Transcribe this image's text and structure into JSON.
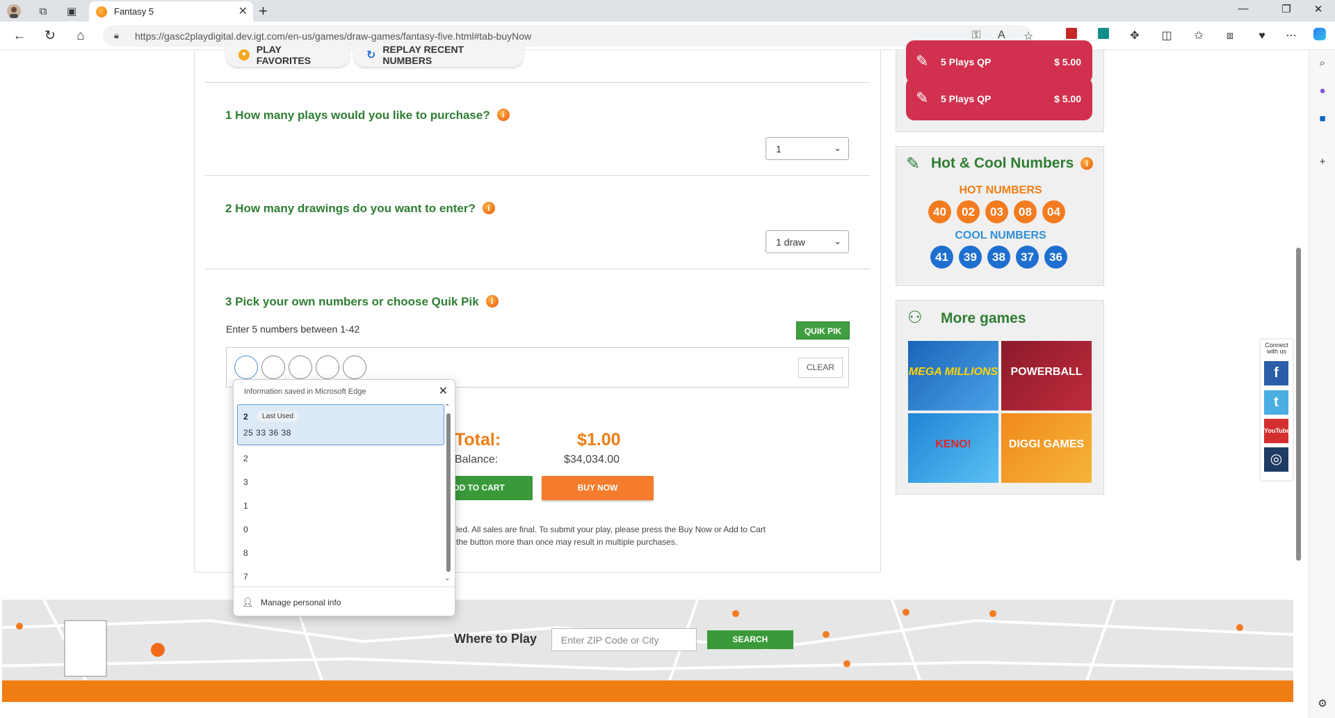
{
  "browser": {
    "tab_title": "Fantasy 5",
    "tab_close": "✕",
    "new_tab": "+",
    "url": "https://gasc2playdigital.dev.igt.com/en-us/games/draw-games/fantasy-five.html#tab-buyNow"
  },
  "favorites_buttons": {
    "play_favorites": "PLAY FAVORITES",
    "replay_recent": "REPLAY RECENT NUMBERS"
  },
  "questions": {
    "q1": "1 How many plays would you like to purchase?",
    "q1_value": "1",
    "q2": "2 How many drawings do you want to enter?",
    "q2_value": "1 draw",
    "q3": "3 Pick your own numbers or choose Quik Pik",
    "q3_hint": "Enter 5 numbers between 1-42",
    "quik_pik": "QUIK PIK",
    "clear": "CLEAR"
  },
  "summary": {
    "total_label": "Total:",
    "total_value": "$1.00",
    "balance_label": "Balance:",
    "balance_value": "$34,034.00",
    "add_to_cart": "DD TO CART",
    "buy_now": "BUY NOW",
    "disclaimer_1": "led. All sales are final. To submit your play, please press the Buy Now or Add to Cart",
    "disclaimer_2": "the button more than once may result in multiple purchases."
  },
  "quick_plays": [
    {
      "label": "5 Plays QP",
      "price": "$ 5.00"
    },
    {
      "label": "5 Plays QP",
      "price": "$ 5.00"
    }
  ],
  "hot_cool": {
    "title": "Hot & Cool Numbers",
    "hot_label": "HOT NUMBERS",
    "hot": [
      "40",
      "02",
      "03",
      "08",
      "04"
    ],
    "cool_label": "COOL NUMBERS",
    "cool": [
      "41",
      "39",
      "38",
      "37",
      "36"
    ]
  },
  "more_games": {
    "title": "More games",
    "tiles": [
      "MEGA MILLIONS",
      "POWERBALL",
      "KENO!",
      "DIGGI GAMES"
    ]
  },
  "social": {
    "connect": "Connect with us",
    "facebook": "f",
    "twitter": "t",
    "youtube": "YouTube"
  },
  "autofill": {
    "header": "Information saved in Microsoft Edge",
    "selected_number": "2",
    "last_used": "Last Used",
    "selected_values": "25  33  36  38",
    "items": [
      "2",
      "3",
      "1",
      "0",
      "8",
      "7"
    ],
    "manage": "Manage personal info"
  },
  "footer": {
    "where_to_play": "Where to Play",
    "zip_placeholder": "Enter ZIP Code or City",
    "search": "SEARCH"
  },
  "colors": {
    "green": "#2e7d32",
    "orange": "#ef7d14",
    "red": "#d1304e",
    "blue": "#1e6fd0"
  }
}
